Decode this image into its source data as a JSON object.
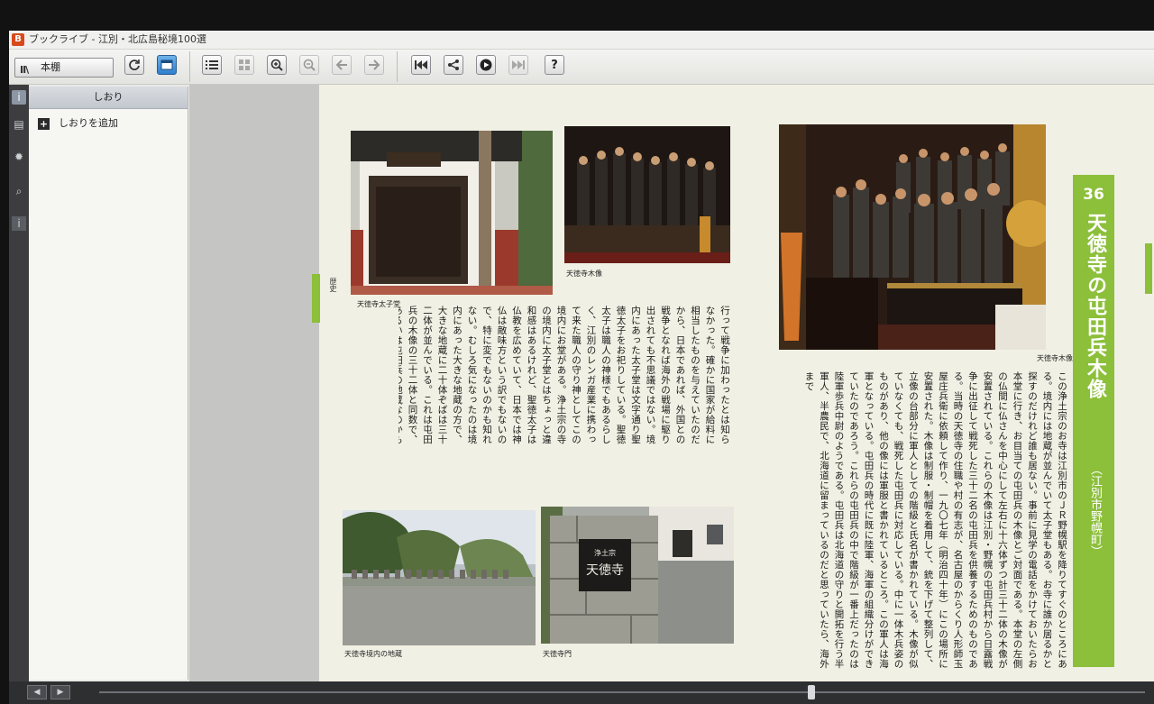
{
  "app": {
    "title": "ブックライブ - 江別・北広島秘境100選",
    "icon_letter": "B"
  },
  "toolbar": {
    "bookshelf_label": "本棚",
    "buttons": [
      {
        "name": "refresh-icon",
        "glyph": "⟳"
      },
      {
        "name": "window-view-icon",
        "glyph": "▭"
      },
      {
        "name": "list-icon",
        "glyph": "☰"
      },
      {
        "name": "grid-icon",
        "glyph": "▦"
      },
      {
        "name": "zoom-in-icon",
        "glyph": "⊕"
      },
      {
        "name": "zoom-out-icon",
        "glyph": "⊖"
      },
      {
        "name": "arrow-left-icon",
        "glyph": "←"
      },
      {
        "name": "arrow-right-icon",
        "glyph": "→"
      },
      {
        "name": "skip-back-icon",
        "glyph": "⏮"
      },
      {
        "name": "share-icon",
        "glyph": "<"
      },
      {
        "name": "play-icon",
        "glyph": "▶"
      },
      {
        "name": "skip-forward-icon",
        "glyph": "⏭"
      },
      {
        "name": "help-icon",
        "glyph": "?"
      }
    ]
  },
  "rail": {
    "icons": [
      "info-icon",
      "toc-icon",
      "settings-icon",
      "search-icon",
      "about-icon"
    ]
  },
  "panel": {
    "header": "しおり",
    "add_bookmark": "しおりを追加"
  },
  "page": {
    "number": "36",
    "title": "天徳寺の屯田兵木像",
    "subtitle": "（江別市野幌町）",
    "section_label": "歴史",
    "captions": {
      "photo1": "天徳寺太子堂",
      "photo2": "天徳寺木像",
      "photo3": "天徳寺木像",
      "photo4": "天徳寺境内の地蔵",
      "photo5": "天徳寺門"
    },
    "gate_plaque": {
      "top": "浄土宗",
      "main": "天徳寺"
    },
    "body_right": "この浄土宗のお寺は江別市のＪＲ野幌駅を降りてすぐのところにある。境内には地蔵が並んでいて太子堂もある。お寺に誰か居るかと探すのだけれど誰も居ない。事前に見学の電話をかけておいたらお本堂に行き、お目当ての屯田兵の木像とご対面である。本堂の左側の仏間に仏さんを中心にして左右に十六体ずつ計三十二体の木像が安置されている。これらの木像は江別・野幌の屯田兵村から日露戦争に出征して戦死した三十二名の屯田兵を供養するためのものである。当時の天徳寺の住職や村の有志が、名古屋のからくり人形師玉屋庄兵衛に依頼して作り、一九〇七年（明治四十年）にこの場所に安置された。木像は制服・制帽を着用して、銃を下げて整列して、立像の台部分に軍人としての階級と氏名が書かれている。木像が似ていなくても、戦死した屯田兵に対応している。中に一体木兵姿のものがあり、他の像には軍服と書かれているところ。この軍人は海軍となっている。屯田兵の時代に既に陸軍、海軍の組織分けができていたのであろう。これらの屯田兵の中で階級が一番上だったのは陸軍歩兵中尉のようである。屯田兵は北海道の守りと開拓を行う半軍人、半農民で、北海道に留まっているのだと思っていたら、海外まで",
    "body_middle": "行って戦争に加わったとは知らなかった。確かに国家が給料に相当したものを与えていたのだから、日本であれば、外国との戦争となれば海外の戦場に駆り出されても不思議ではない。境内にあった太子堂は文字通り聖徳太子をお祀りしている。聖徳太子は職人の神様でもあるらしく、江別のレンガ産業に携わって来た職人の守り神としてこの境内にお堂がある。浄土宗の寺の境内に太子堂とはちょっと違和感はあるけれど、聖徳太子は仏教を広めていて、日本では神仏は敵味方という訳でもないので、特に変でもないのかも知れない。むしろ気になったのは境内にあった大きな地蔵の方で、大きな地蔵に二十体ぞばは三十二体が並んでいる。これは屯田兵の木像の三十二体と同数で、あるいは屯田兵の地蔵なのかも知れない。しかし、寺には誰も居なかったのでこの点を確かめる術はなかった。"
  }
}
